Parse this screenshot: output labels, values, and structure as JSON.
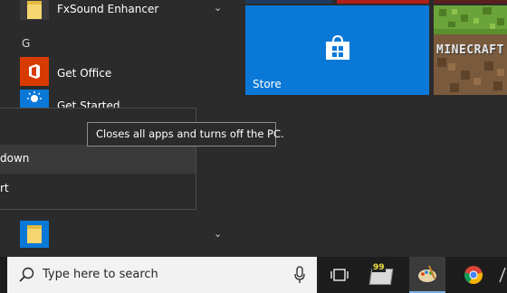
{
  "apps": {
    "fxsound_label": "FxSound Enhancer",
    "section_letter": "G",
    "get_office_label": "Get Office",
    "get_started_label": "Get Started"
  },
  "tiles": {
    "store_label": "Store",
    "minecraft_label": "MINECRAFT"
  },
  "power_menu": {
    "item1_label": "",
    "shutdown_label": "down",
    "restart_label": "rt"
  },
  "tooltip": {
    "text": "Closes all apps and turns off the PC."
  },
  "taskbar": {
    "search_placeholder": "Type here to search",
    "cpu_badge": "99"
  }
}
